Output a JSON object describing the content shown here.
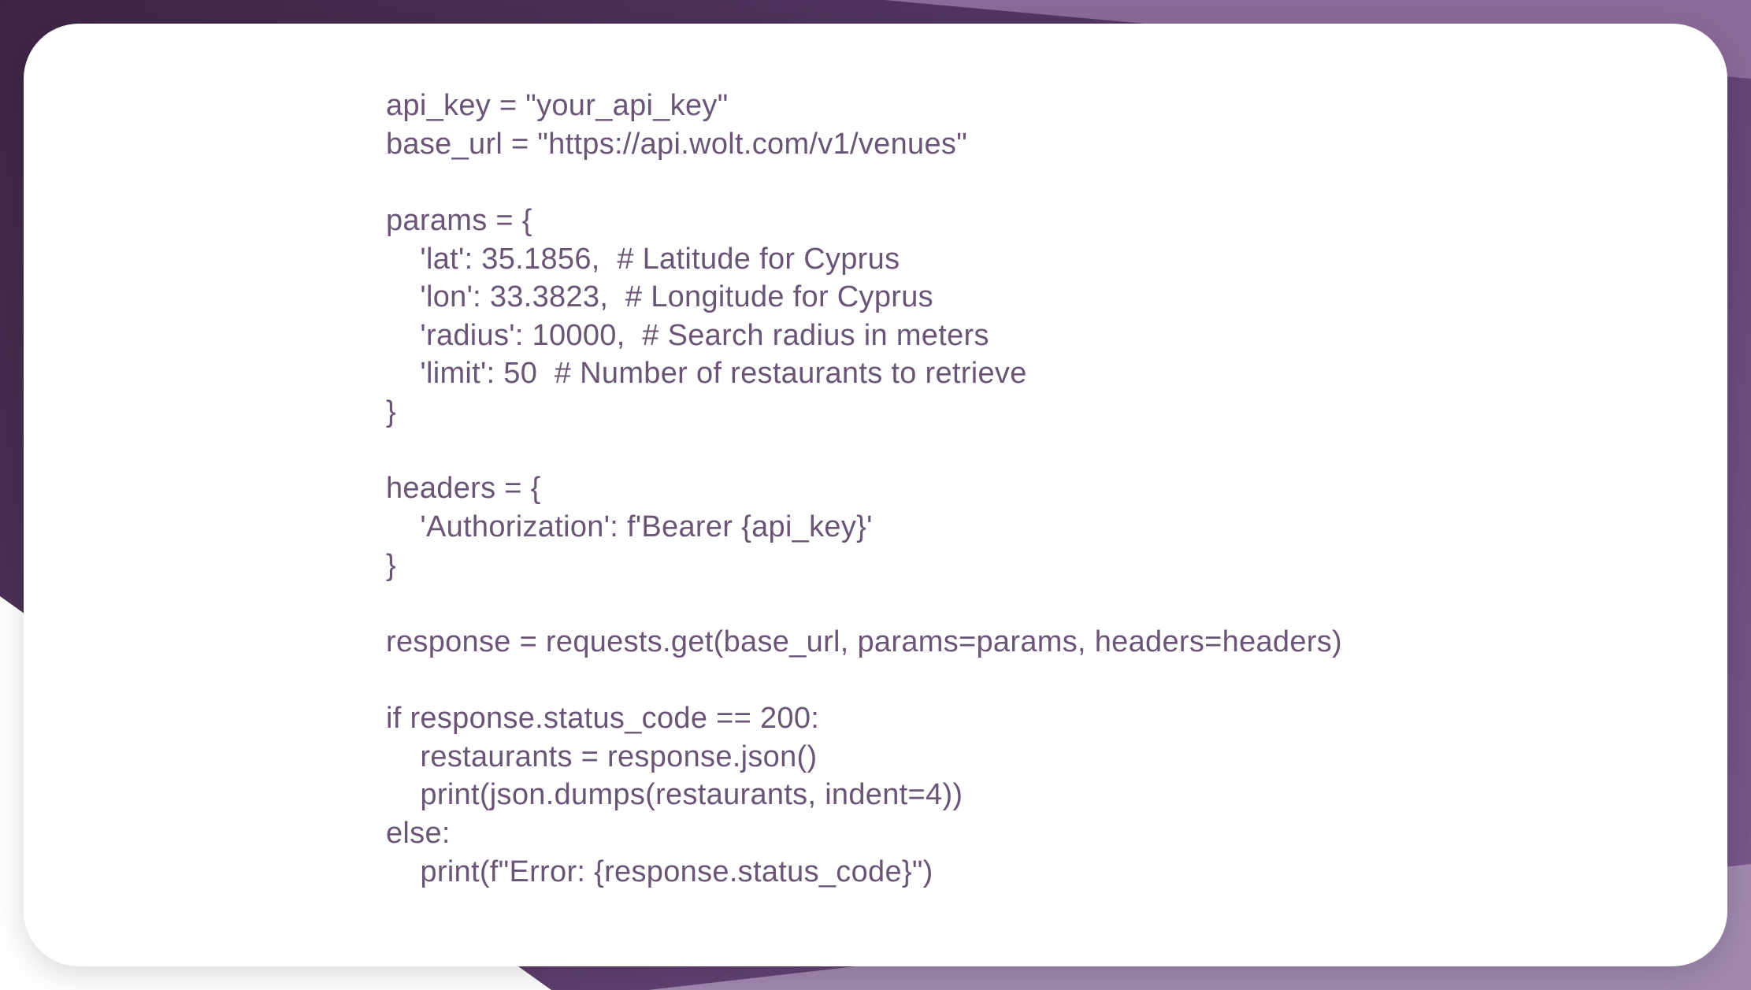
{
  "code": {
    "lines": [
      "api_key = \"your_api_key\"",
      "base_url = \"https://api.wolt.com/v1/venues\"",
      "",
      "params = {",
      "    'lat': 35.1856,  # Latitude for Cyprus",
      "    'lon': 33.3823,  # Longitude for Cyprus",
      "    'radius': 10000,  # Search radius in meters",
      "    'limit': 50  # Number of restaurants to retrieve",
      "}",
      "",
      "headers = {",
      "    'Authorization': f'Bearer {api_key}'",
      "}",
      "",
      "response = requests.get(base_url, params=params, headers=headers)",
      "",
      "if response.status_code == 200:",
      "    restaurants = response.json()",
      "    print(json.dumps(restaurants, indent=4))",
      "else:",
      "    print(f\"Error: {response.status_code}\")"
    ]
  }
}
